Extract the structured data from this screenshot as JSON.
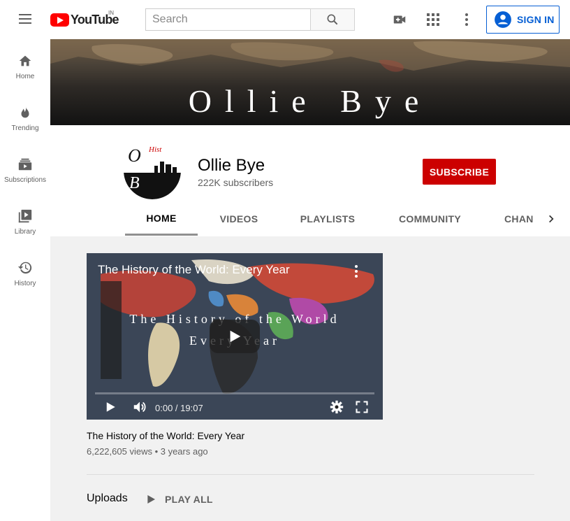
{
  "app": {
    "logo_text": "YouTube",
    "logo_region": "IN"
  },
  "search": {
    "placeholder": "Search"
  },
  "header": {
    "signin_label": "SIGN IN"
  },
  "sidebar": {
    "items": [
      {
        "label": "Home",
        "icon": "home-icon"
      },
      {
        "label": "Trending",
        "icon": "trending-icon"
      },
      {
        "label": "Subscriptions",
        "icon": "subscriptions-icon"
      },
      {
        "label": "Library",
        "icon": "library-icon"
      },
      {
        "label": "History",
        "icon": "history-icon"
      }
    ]
  },
  "banner": {
    "title": "Ollie Bye"
  },
  "channel": {
    "name": "Ollie Bye",
    "subscribers": "222K subscribers",
    "subscribe_label": "SUBSCRIBE",
    "tabs": [
      "HOME",
      "VIDEOS",
      "PLAYLISTS",
      "COMMUNITY",
      "CHAN"
    ],
    "active_tab": "HOME"
  },
  "featured_video": {
    "player_title": "The History of the World: Every Year",
    "overlay_line1": "The History of the World",
    "overlay_line2": "Every Year",
    "time": "0:00 / 19:07",
    "title": "The History of the World: Every Year",
    "meta": "6,222,605 views • 3 years ago"
  },
  "uploads": {
    "heading": "Uploads",
    "play_all_label": "PLAY ALL"
  },
  "colors": {
    "brand_red": "#ff0000",
    "subscribe_red": "#cc0000",
    "link_blue": "#065fd4"
  }
}
